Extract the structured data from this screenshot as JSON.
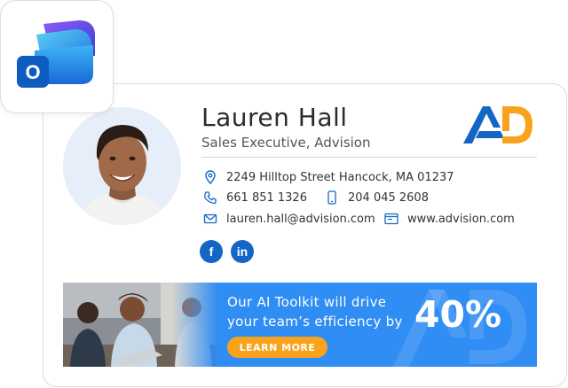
{
  "app_icon": {
    "name": "outlook-icon",
    "letter": "O",
    "accent": "#0f6cbd"
  },
  "profile": {
    "name": "Lauren Hall",
    "title": "Sales Executive, Advision"
  },
  "contact": {
    "address": "2249 Hilltop Street Hancock, MA 01237",
    "phone": "661 851 1326",
    "mobile": "204 045 2608",
    "email": "lauren.hall@advision.com",
    "website": "www.advision.com"
  },
  "social": {
    "facebook": "f",
    "linkedin": "in"
  },
  "banner": {
    "line1": "Our AI Toolkit will drive",
    "line2": "your team’s efficiency by",
    "percent": "40%",
    "cta": "LEARN MORE"
  },
  "colors": {
    "brand_blue": "#1466c5",
    "brand_orange": "#f9a31c",
    "banner_blue": "#2f8df3"
  }
}
